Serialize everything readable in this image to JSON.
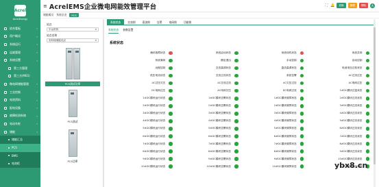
{
  "logo": {
    "mark": "Acrel",
    "name": "AcrelEnergy"
  },
  "sidebar": {
    "items": [
      {
        "label": "综合看板",
        "kind": "top"
      },
      {
        "label": "用户概况",
        "kind": "top"
      },
      {
        "label": "系统运行",
        "kind": "top"
      },
      {
        "label": "运维管理",
        "kind": "top"
      },
      {
        "label": "系统设置",
        "kind": "top"
      },
      {
        "label": "第三方管理",
        "kind": "sub"
      },
      {
        "label": "第三方(MES)",
        "kind": "sub"
      },
      {
        "label": "微电网储能管理",
        "kind": "top"
      },
      {
        "label": "工业控制",
        "kind": "top"
      },
      {
        "label": "电池资料",
        "kind": "top"
      },
      {
        "label": "配电设备",
        "kind": "top"
      },
      {
        "label": "故障检测系统",
        "kind": "top"
      },
      {
        "label": "电动车桩",
        "kind": "top"
      },
      {
        "label": "储能",
        "kind": "top"
      },
      {
        "label": "储能汇总",
        "kind": "child"
      },
      {
        "label": "PCS",
        "kind": "child-sel"
      },
      {
        "label": "BMS",
        "kind": "child"
      },
      {
        "label": "电池柜",
        "kind": "child"
      }
    ]
  },
  "topbar": {
    "menu_icon": "≡",
    "title": "AcrelEMS企业微电网能效管理平台",
    "btn1": "切换",
    "btn2": "管理",
    "btn3": "帮助",
    "avatar": "A",
    "btn1_color": "#2e9a74",
    "btn2_color": "#f0a020",
    "btn3_color": "#e05050"
  },
  "breadcrumb": {
    "home": "储能概况",
    "current": "系统总览",
    "tag": "PCS"
  },
  "left": {
    "station_label": "站点",
    "station_value": "平台机构",
    "device_label": "站点名称",
    "device_value": "安科瑞储能站点",
    "devices": [
      "PCS测试功率",
      "PCS测试",
      "PCS功率"
    ]
  },
  "tabs": [
    "系统状态",
    "交流侧",
    "直流侧",
    "告警",
    "电网侧",
    "功能侧"
  ],
  "subtabs": [
    "系统状态",
    "参数设置"
  ],
  "section_title": "系统状态",
  "colors": {
    "green": "#2aa33a",
    "red": "#e05252",
    "accent": "#2e9a74"
  },
  "status": [
    {
      "l": "通讯故障状态",
      "s": "red"
    },
    {
      "l": "系统启动状态",
      "s": "green"
    },
    {
      "l": "系统待机状态",
      "s": "red"
    },
    {
      "l": "系统并网",
      "s": "green"
    },
    {
      "l": "系统离网",
      "s": "green"
    },
    {
      "l": "额定退出",
      "s": "green"
    },
    {
      "l": "手动控制",
      "s": "green"
    },
    {
      "l": "自动控制",
      "s": "green"
    },
    {
      "l": "远程控制",
      "s": "green"
    },
    {
      "l": "交流高调状态",
      "s": "green"
    },
    {
      "l": "直流高调状态",
      "s": "green"
    },
    {
      "l": "电池电压过低状态",
      "s": "green"
    },
    {
      "l": "低压电流状态",
      "s": "green"
    },
    {
      "l": "交流过流状态",
      "s": "green"
    },
    {
      "l": "系统告警",
      "s": "green"
    },
    {
      "l": "AC过流过压",
      "s": "green"
    },
    {
      "l": "AC过压欠压",
      "s": "green"
    },
    {
      "l": "AC交流过流",
      "s": "green"
    },
    {
      "l": "AC欠压过压",
      "s": "green"
    },
    {
      "l": "AC电网过压",
      "s": "green"
    },
    {
      "l": "DC电网过压",
      "s": "green"
    },
    {
      "l": "AC电网欠压",
      "s": "green"
    },
    {
      "l": "DC电网过流",
      "s": "green"
    },
    {
      "l": "1#DC模块过温状态",
      "s": "green"
    },
    {
      "l": "1#DC模块运行状态",
      "s": "green"
    },
    {
      "l": "1#DC模块告警状态",
      "s": "green"
    },
    {
      "l": "1#DC模块故障状态",
      "s": "green"
    },
    {
      "l": "2#DC模块过流状态",
      "s": "green"
    },
    {
      "l": "2#DC模块运行状态",
      "s": "green"
    },
    {
      "l": "2#DC模块告警状态",
      "s": "green"
    },
    {
      "l": "2#DC模块故障状态",
      "s": "green"
    },
    {
      "l": "3#DC模块过流状态",
      "s": "green"
    },
    {
      "l": "3#DC模块运行状态",
      "s": "green"
    },
    {
      "l": "3#DC模块告警状态",
      "s": "green"
    },
    {
      "l": "3#DC模块故障状态",
      "s": "green"
    },
    {
      "l": "4#DC模块过流状态",
      "s": "green"
    },
    {
      "l": "4#DC模块运行状态",
      "s": "green"
    },
    {
      "l": "4#DC模块告警状态",
      "s": "green"
    },
    {
      "l": "4#DC模块故障状态",
      "s": "green"
    },
    {
      "l": "5#DC模块过流状态",
      "s": "green"
    },
    {
      "l": "5#DC模块运行状态",
      "s": "green"
    },
    {
      "l": "5#DC模块告警状态",
      "s": "green"
    },
    {
      "l": "5#DC模块故障状态",
      "s": "green"
    },
    {
      "l": "6#DC模块过流状态",
      "s": "green"
    },
    {
      "l": "6#DC模块运行状态",
      "s": "green"
    },
    {
      "l": "6#DC模块告警状态",
      "s": "green"
    },
    {
      "l": "6#DC模块故障状态",
      "s": "green"
    },
    {
      "l": "7#DC模块过流状态",
      "s": "green"
    },
    {
      "l": "7#DC模块运行状态",
      "s": "green"
    },
    {
      "l": "7#DC模块告警状态",
      "s": "green"
    },
    {
      "l": "7#DC模块故障状态",
      "s": "green"
    },
    {
      "l": "8#DC模块过流状态",
      "s": "green"
    },
    {
      "l": "8#DC模块运行状态",
      "s": "green"
    },
    {
      "l": "8#DC模块告警状态",
      "s": "green"
    },
    {
      "l": "8#DC模块故障状态",
      "s": "green"
    },
    {
      "l": "9#DC模块过流状态",
      "s": "green"
    },
    {
      "l": "9#DC模块运行状态",
      "s": "green"
    },
    {
      "l": "9#DC模块告警状态",
      "s": "green"
    },
    {
      "l": "9#DC模块故障状态",
      "s": "green"
    },
    {
      "l": "10#DC模块过流状态",
      "s": "green"
    },
    {
      "l": "10#DC模块运行状态",
      "s": "green"
    },
    {
      "l": "10#DC模块告警状态",
      "s": "green"
    },
    {
      "l": "10#DC模块故障状态",
      "s": "green"
    },
    {
      "l": "STS电网电压状态",
      "s": "green"
    }
  ],
  "watermark": "ybx8.cn"
}
